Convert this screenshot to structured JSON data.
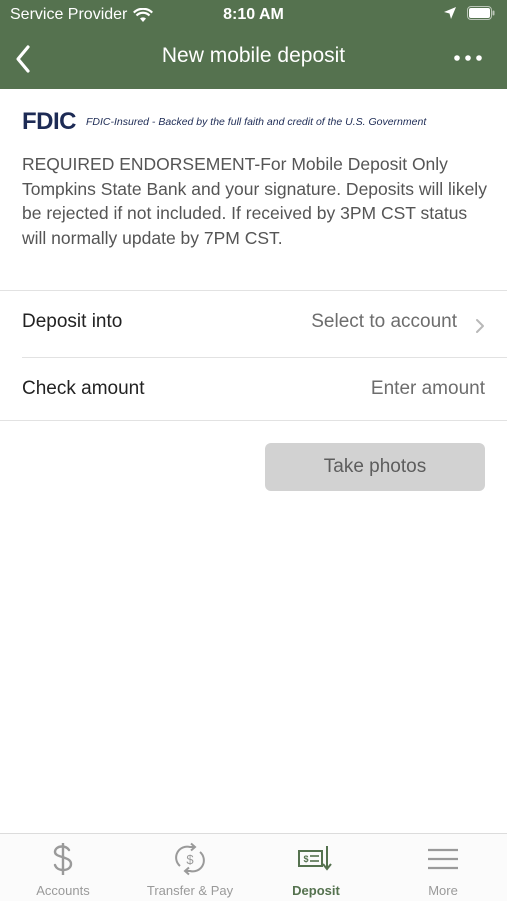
{
  "status_bar": {
    "carrier": "Service Provider",
    "time": "8:10 AM"
  },
  "nav": {
    "title": "New mobile deposit"
  },
  "fdic": {
    "logo": "FDIC",
    "tagline": "FDIC-Insured - Backed by the full faith and credit of the U.S. Government"
  },
  "notice": "REQUIRED ENDORSEMENT-For Mobile Deposit Only Tompkins State Bank and your signature. Deposits will likely be rejected if not included. If received by 3PM CST status will normally update by 7PM CST.",
  "form": {
    "deposit_into": {
      "label": "Deposit into",
      "value": "Select to account"
    },
    "check_amount": {
      "label": "Check amount",
      "placeholder": "Enter amount"
    }
  },
  "take_photos_label": "Take photos",
  "tabs": [
    {
      "label": "Accounts",
      "icon": "dollar-icon",
      "active": false
    },
    {
      "label": "Transfer & Pay",
      "icon": "transfer-icon",
      "active": false
    },
    {
      "label": "Deposit",
      "icon": "deposit-check-icon",
      "active": true
    },
    {
      "label": "More",
      "icon": "menu-icon",
      "active": false
    }
  ],
  "colors": {
    "header": "#55724f",
    "active_tab": "#55724f",
    "fdic_blue": "#1d2b55"
  }
}
